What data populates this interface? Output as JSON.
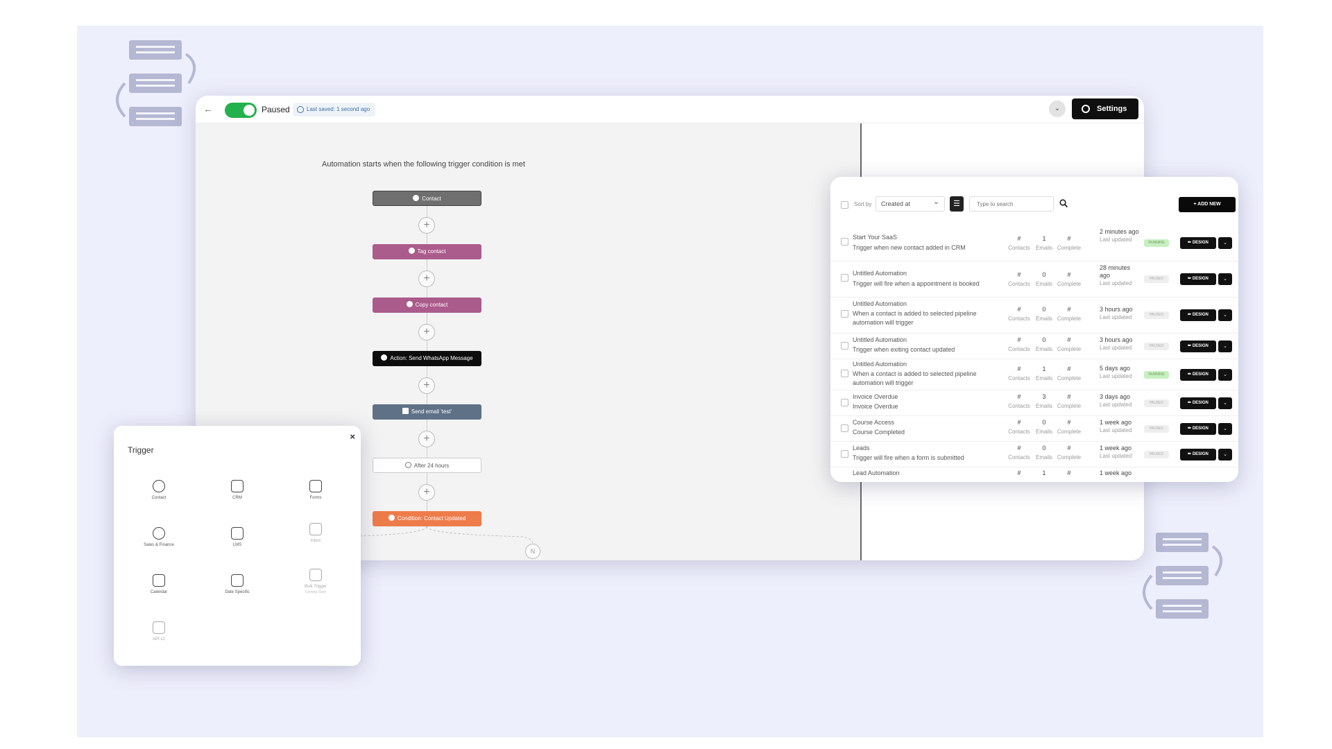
{
  "editor": {
    "status_label": "Paused",
    "last_saved": "Last saved: 1 second ago",
    "settings_label": "Settings",
    "canvas_title": "Automation starts when the following trigger condition is met",
    "nodes": {
      "contact": "Contact",
      "tag": "Tag contact",
      "copy": "Copy contact",
      "whatsapp": "Action: Send WhatsApp Message",
      "email": "Send email 'test'",
      "wait": "After 24 hours",
      "condition": "Condition: Contact Updated"
    },
    "branch_badge": "N"
  },
  "list_panel": {
    "sort_label": "Sort by",
    "sort_value": "Created at",
    "search_placeholder": "Type to search",
    "add_label": "+ ADD NEW",
    "stat_keys": {
      "contacts": "Contacts",
      "emails": "Emails",
      "complete": "Complete",
      "updated": "Last updated"
    },
    "design_label": "✏ DESIGN",
    "rows": [
      {
        "title": "Start Your SaaS",
        "desc": "Trigger when new contact added in CRM",
        "contacts": "#",
        "emails": "1",
        "complete": "#",
        "updated": "2 minutes ago",
        "status": "RUNNING"
      },
      {
        "title": "Untitled Automation",
        "desc": "Trigger will fire when a appointment is booked",
        "contacts": "#",
        "emails": "0",
        "complete": "#",
        "updated": "28 minutes ago",
        "status": "PAUSED"
      },
      {
        "title": "Untitled Automation",
        "desc": "When a contact is added to selected pipeline automation will trigger",
        "contacts": "#",
        "emails": "0",
        "complete": "#",
        "updated": "3 hours ago",
        "status": "PAUSED"
      },
      {
        "title": "Untitled Automation",
        "desc": "Trigger when exiting contact updated",
        "contacts": "#",
        "emails": "0",
        "complete": "#",
        "updated": "3 hours ago",
        "status": "PAUSED"
      },
      {
        "title": "Untitled Automation",
        "desc": "When a contact is added to selected pipeline automation will trigger",
        "contacts": "#",
        "emails": "1",
        "complete": "#",
        "updated": "5 days ago",
        "status": "RUNNING"
      },
      {
        "title": "Invoice Overdue",
        "desc": "Invoice Overdue",
        "contacts": "#",
        "emails": "3",
        "complete": "#",
        "updated": "3 days ago",
        "status": "PAUSED"
      },
      {
        "title": "Course Access",
        "desc": "Course Completed",
        "contacts": "#",
        "emails": "0",
        "complete": "#",
        "updated": "1 week ago",
        "status": "PAUSED"
      },
      {
        "title": "Leads",
        "desc": "Trigger will fire when a form is submitted",
        "contacts": "#",
        "emails": "0",
        "complete": "#",
        "updated": "1 week ago",
        "status": "PAUSED"
      },
      {
        "title": "Lead Automation",
        "desc": "",
        "contacts": "#",
        "emails": "1",
        "complete": "#",
        "updated": "1 week ago",
        "status": ""
      }
    ]
  },
  "trigger": {
    "title": "Trigger",
    "close": "×",
    "tiles": [
      {
        "label": "Contact",
        "icon": "person-icon"
      },
      {
        "label": "CRM",
        "icon": "crm-icon"
      },
      {
        "label": "Forms",
        "icon": "form-icon"
      },
      {
        "label": "Sales & Finance",
        "icon": "money-icon"
      },
      {
        "label": "LMS",
        "icon": "lms-icon"
      },
      {
        "label": "Inbox",
        "icon": "inbox-icon"
      },
      {
        "label": "Calendar",
        "icon": "calendar-icon"
      },
      {
        "label": "Date Specific",
        "icon": "date-icon"
      },
      {
        "label": "Bulk Trigger",
        "sub": "Coming Soon",
        "icon": "bulk-icon"
      },
      {
        "label": "API v2",
        "icon": "code-icon"
      }
    ]
  }
}
